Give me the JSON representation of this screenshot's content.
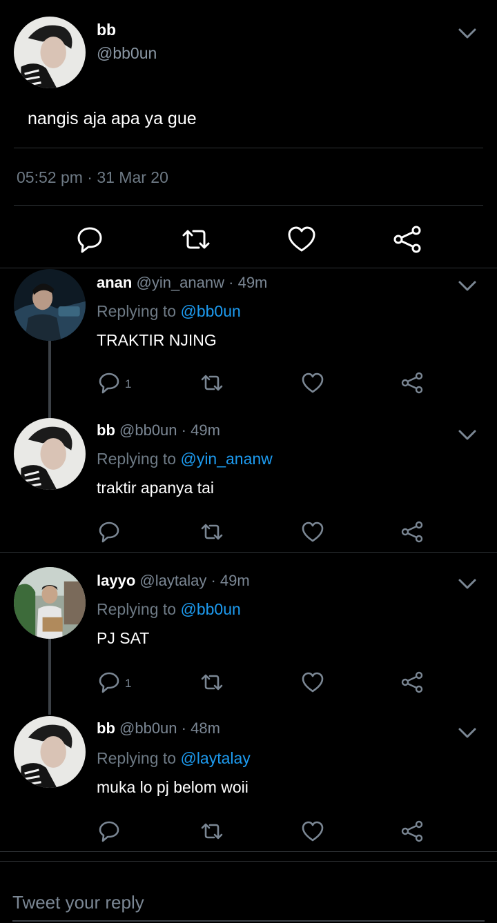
{
  "main_tweet": {
    "name": "bb",
    "handle": "@bb0un",
    "text": "nangis aja apa ya gue",
    "timestamp": "05:52 pm · 31 Mar 20"
  },
  "replies": [
    {
      "name": "anan",
      "handle": "@yin_ananw",
      "time": "· 49m",
      "replying_prefix": "Replying to",
      "replying_to": "@bb0un",
      "text": "TRAKTIR NJING",
      "reply_count": "1"
    },
    {
      "name": "bb",
      "handle": "@bb0un",
      "time": "· 49m",
      "replying_prefix": "Replying to",
      "replying_to": "@yin_ananw",
      "text": "traktir apanya tai",
      "reply_count": ""
    },
    {
      "name": "layyo",
      "handle": "@laytalay",
      "time": "· 49m",
      "replying_prefix": "Replying to",
      "replying_to": "@bb0un",
      "text": "PJ SAT",
      "reply_count": "1"
    },
    {
      "name": "bb",
      "handle": "@bb0un",
      "time": "· 48m",
      "replying_prefix": "Replying to",
      "replying_to": "@laytalay",
      "text": "muka lo pj belom woii",
      "reply_count": ""
    }
  ],
  "compose": {
    "placeholder": "Tweet your reply"
  },
  "icons": [
    "reply-icon",
    "retweet-icon",
    "like-icon",
    "share-icon",
    "chevron-down-icon"
  ],
  "colors": {
    "background": "#000000",
    "accent": "#1d9bf0",
    "muted": "#7b8794",
    "divider": "#2f3336"
  }
}
